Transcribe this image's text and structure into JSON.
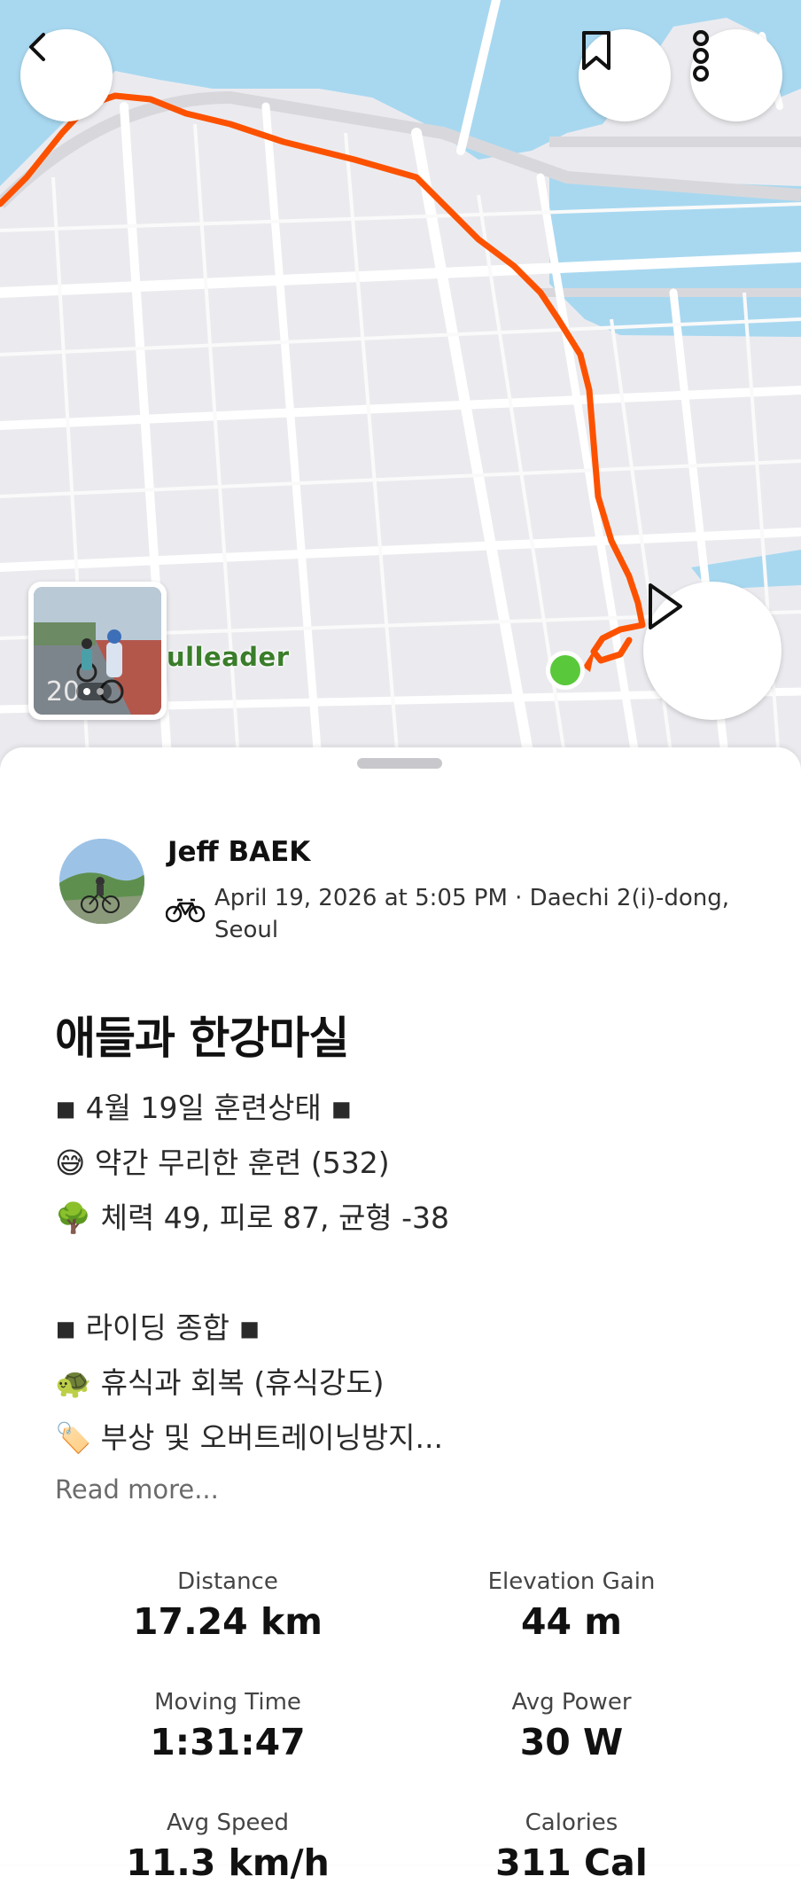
{
  "map": {
    "map_label": "ulleader",
    "buttons": {
      "back_icon": "chevron-left-icon",
      "bookmark_icon": "bookmark-icon",
      "more_icon": "more-vertical-icon",
      "play_icon": "play-icon"
    },
    "route_color": "#fc5200",
    "water_color": "#a8d8f0",
    "start_color": "#5ac83b"
  },
  "activity": {
    "athlete_name": "Jeff BAEK",
    "sport_icon": "bicycle-icon",
    "date_location": "April 19, 2026 at 5:05 PM · Daechi 2(i)-dong, Seoul",
    "title": "애들과 한강마실",
    "description_lines": [
      "◾ 4월 19일 훈련상태 ◾",
      "😅 약간 무리한 훈련 (532)",
      "🌳 체력 49, 피로 87, 균형 -38",
      "",
      "◾ 라이딩 종합 ◾",
      "🐢 휴식과 회복 (휴식강도)",
      "🏷️ 부상 및 오버트레이닝방지..."
    ],
    "read_more": "Read more..."
  },
  "stats": {
    "distance": {
      "label": "Distance",
      "value": "17.24 km"
    },
    "elevation": {
      "label": "Elevation Gain",
      "value": "44 m"
    },
    "moving_time": {
      "label": "Moving Time",
      "value": "1:31:47"
    },
    "avg_power": {
      "label": "Avg Power",
      "value": "30 W"
    },
    "avg_speed": {
      "label": "Avg Speed",
      "value": "11.3 km/h"
    },
    "calories": {
      "label": "Calories",
      "value": "311 Cal"
    }
  }
}
